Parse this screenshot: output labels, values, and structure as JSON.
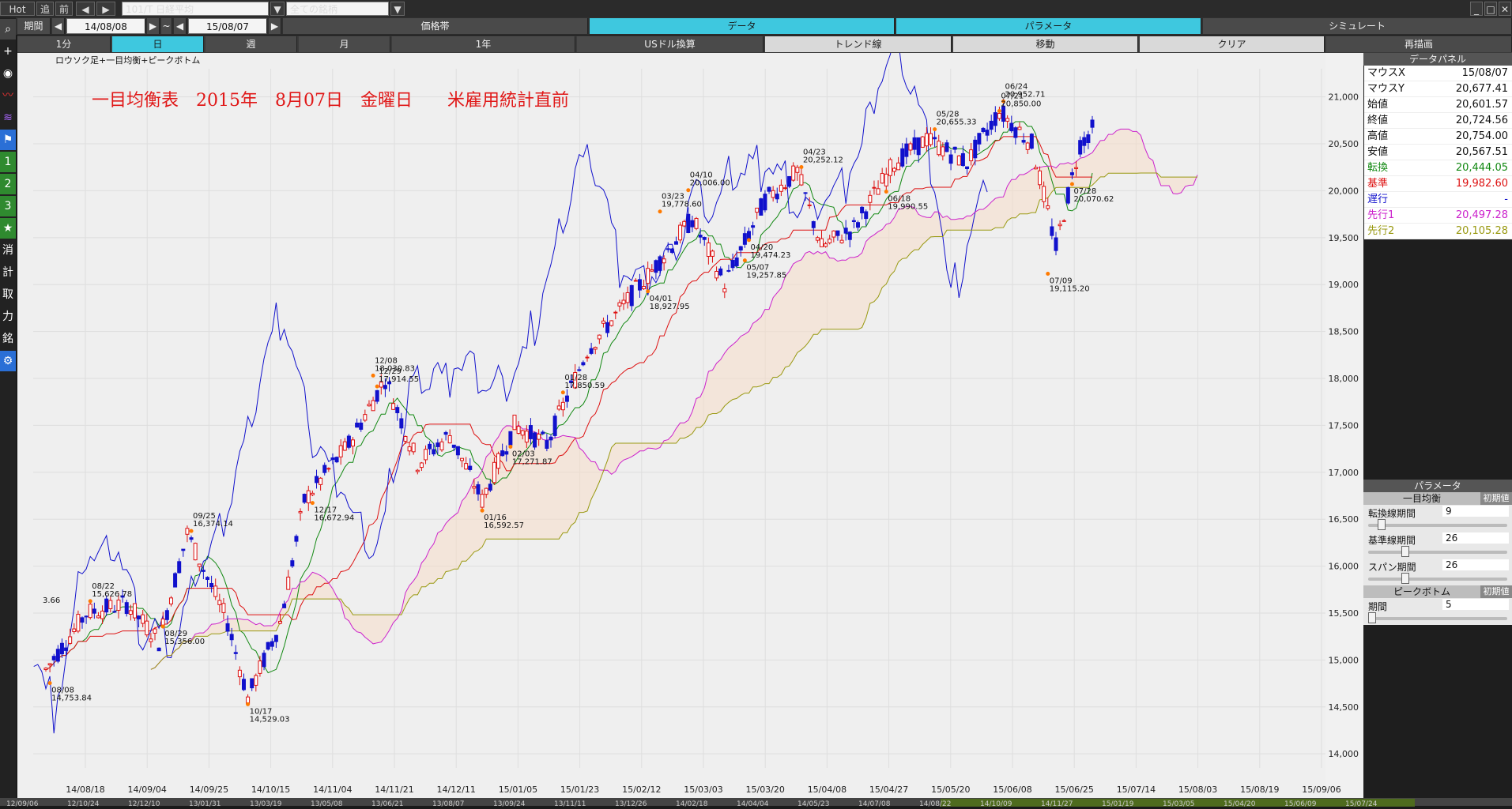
{
  "toolbar": {
    "hot": "Hot",
    "add": "追",
    "prev": "前",
    "back_arrow": "◀",
    "fwd_arrow": "▶",
    "symbol": "101/T 日経平均",
    "filter": "全ての銘柄",
    "period_label": "期間",
    "date_from": "14/08/08",
    "tilde": "~",
    "date_to": "15/08/07",
    "price_band": "価格帯",
    "data": "データ",
    "parameter": "パラメータ",
    "simulate": "シミュレート"
  },
  "timeframes": [
    "1分",
    "日",
    "週",
    "月",
    "1年"
  ],
  "actions": {
    "usd": "USドル換算",
    "trend": "トレンド線",
    "move": "移動",
    "clear": "クリア",
    "redraw": "再描画"
  },
  "sidebar_icons": [
    "search-icon",
    "crosshair-icon",
    "camera-icon",
    "line-chart-icon",
    "multi-line-icon",
    "flag-icon",
    "1",
    "2",
    "3",
    "★",
    "消",
    "計",
    "取",
    "力",
    "銘",
    "gear-icon"
  ],
  "chart": {
    "legend": "ロウソク足+一目均衡+ピークボトム",
    "title": "一目均衡表　2015年　8月07日　金曜日　　米雇用統計直前",
    "yticks": [
      "21,000",
      "20,500",
      "20,000",
      "19,500",
      "19,000",
      "18,500",
      "18,000",
      "17,500",
      "17,000",
      "16,500",
      "16,000",
      "15,500",
      "15,000",
      "14,500",
      "14,000"
    ],
    "xticks": [
      "14/08/18",
      "14/09/04",
      "14/09/25",
      "14/10/15",
      "14/11/04",
      "14/11/21",
      "14/12/11",
      "15/01/05",
      "15/01/23",
      "15/02/12",
      "15/03/03",
      "15/03/20",
      "15/04/08",
      "15/04/27",
      "15/05/20",
      "15/06/08",
      "15/06/25",
      "15/07/14",
      "15/08/03",
      "15/08/19",
      "15/09/06"
    ],
    "bottom_ticks": [
      "12/09/06",
      "12/10/24",
      "12/12/10",
      "13/01/31",
      "13/03/19",
      "13/05/08",
      "13/06/21",
      "13/08/07",
      "13/09/24",
      "13/11/11",
      "13/12/26",
      "14/02/18",
      "14/04/04",
      "14/05/23",
      "14/07/08",
      "14/08/22",
      "14/10/09",
      "14/11/27",
      "15/01/19",
      "15/03/05",
      "15/04/20",
      "15/06/09",
      "15/07/24"
    ],
    "peak_labels": [
      {
        "date": "08/22",
        "value": "15,626.78"
      },
      {
        "date": "09/25",
        "value": "16,374.14"
      },
      {
        "date": "12/08",
        "value": "18,030.83"
      },
      {
        "date": "12/29",
        "value": "17,914.55"
      },
      {
        "date": "01/28",
        "value": "17,850.59"
      },
      {
        "date": "03/23",
        "value": "19,778.60"
      },
      {
        "date": "04/10",
        "value": "20,006.00"
      },
      {
        "date": "04/23",
        "value": "20,252.12"
      },
      {
        "date": "05/28",
        "value": "20,655.33"
      },
      {
        "date": "06/24",
        "value": "20,952.71"
      },
      {
        "date": "07/21",
        "value": "20,850.00"
      }
    ],
    "bottom_labels": [
      {
        "date": "08/08",
        "value": "14,753.84"
      },
      {
        "date": "08/29",
        "value": "15,356.00"
      },
      {
        "date": "10/17",
        "value": "14,529.03"
      },
      {
        "date": "12/17",
        "value": "16,672.94"
      },
      {
        "date": "01/16",
        "value": "16,592.57"
      },
      {
        "date": "02/03",
        "value": "17,271.87"
      },
      {
        "date": "04/01",
        "value": "18,927.95"
      },
      {
        "date": "04/20",
        "value": "19,474.23"
      },
      {
        "date": "05/07",
        "value": "19,257.85"
      },
      {
        "date": "06/18",
        "value": "19,990.55"
      },
      {
        "date": "07/09",
        "value": "19,115.20"
      },
      {
        "date": "07/28",
        "value": "20,070.62"
      }
    ],
    "edge_label": "3.66"
  },
  "data_panel": {
    "header": "データパネル",
    "rows": [
      {
        "label": "マウスX",
        "value": "15/08/07",
        "color": "#111111"
      },
      {
        "label": "マウスY",
        "value": "20,677.41",
        "color": "#111111"
      },
      {
        "label": "始値",
        "value": "20,601.57",
        "color": "#111111"
      },
      {
        "label": "終値",
        "value": "20,724.56",
        "color": "#111111"
      },
      {
        "label": "高値",
        "value": "20,754.00",
        "color": "#111111"
      },
      {
        "label": "安値",
        "value": "20,567.51",
        "color": "#111111"
      },
      {
        "label": "転換",
        "value": "20,444.05",
        "color": "#118811"
      },
      {
        "label": "基準",
        "value": "19,982.60",
        "color": "#dd1111"
      },
      {
        "label": "遅行",
        "value": "-",
        "color": "#1111cc"
      },
      {
        "label": "先行1",
        "value": "20,497.28",
        "color": "#cc22cc"
      },
      {
        "label": "先行2",
        "value": "20,105.28",
        "color": "#999911"
      }
    ]
  },
  "param_panel": {
    "header": "パラメータ",
    "ichimoku": "一目均衡",
    "reset": "初期値",
    "tenkan_label": "転換線期間",
    "tenkan_value": "9",
    "kijun_label": "基準線期間",
    "kijun_value": "26",
    "span_label": "スパン期間",
    "span_value": "26",
    "peak": "ピークボトム",
    "period_label": "期間",
    "period_value": "5",
    "sliders": {
      "tenkan": 0.07,
      "kijun": 0.25,
      "span": 0.25,
      "period": 0.0
    }
  },
  "colors": {
    "cyan": "#3ec8df",
    "bull": "#dd1111",
    "bear": "#1111cc",
    "tenkan": "#118811",
    "kijun": "#dd1111",
    "chikou": "#1111cc",
    "senkou1": "#cc22cc",
    "senkou2": "#999911"
  }
}
